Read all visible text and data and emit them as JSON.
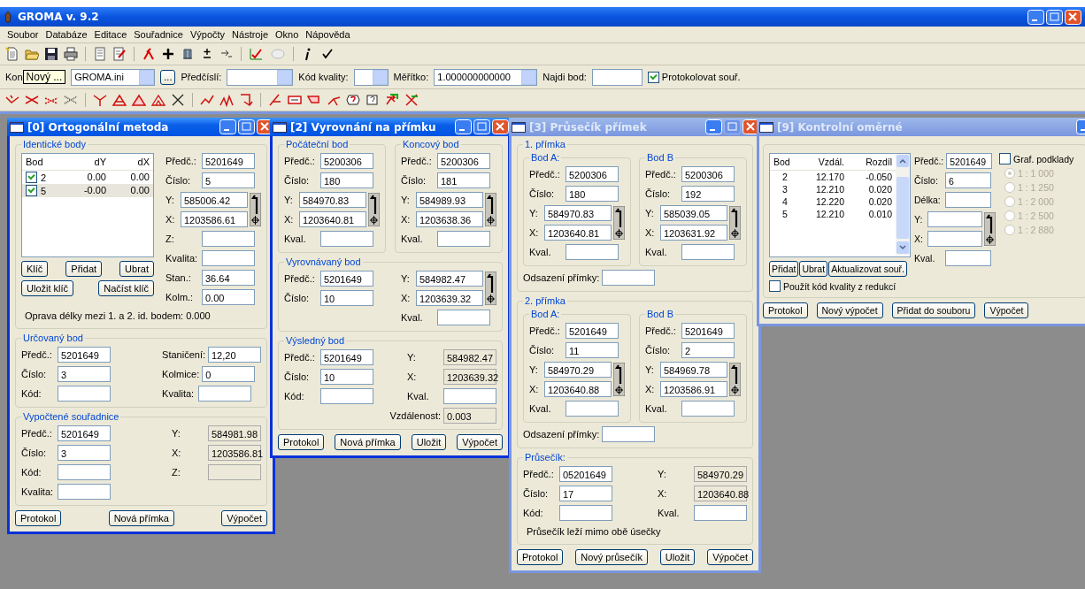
{
  "app": {
    "title": "GROMA v. 9.2"
  },
  "menu": [
    "Soubor",
    "Databáze",
    "Editace",
    "Souřadnice",
    "Výpočty",
    "Nástroje",
    "Okno",
    "Nápověda"
  ],
  "config_bar": [
    {
      "kind": "label",
      "text": "Kon"
    },
    {
      "kind": "tooltip",
      "text": "Nový ..."
    },
    {
      "kind": "combo",
      "value": "GROMA.ini"
    },
    {
      "kind": "button",
      "label": "..."
    },
    {
      "kind": "label",
      "text": "Předčíslí:"
    },
    {
      "kind": "combo"
    },
    {
      "kind": "label",
      "text": "Kód kvality:"
    },
    {
      "kind": "smallcombo"
    },
    {
      "kind": "label",
      "text": "Měřítko:"
    },
    {
      "kind": "combo",
      "value": "1.000000000000"
    },
    {
      "kind": "label",
      "text": "Najdi bod:"
    },
    {
      "kind": "input"
    },
    {
      "kind": "checkbox",
      "label": "Protokolovat souř.",
      "checked": true
    }
  ],
  "windows": [
    {
      "title": "[0] Ortogonální metoda",
      "active": true,
      "content": [
        {
          "kind": "group",
          "legend": "Identické body",
          "items": [
            {
              "kind": "row",
              "items": [
                {
                  "kind": "col",
                  "items": [
                    {
                      "kind": "table",
                      "columns": [
                        "Bod",
                        "dY",
                        "dX"
                      ],
                      "rows": [
                        {
                          "checked": true,
                          "selected": false,
                          "cells": [
                            "2",
                            "0.00",
                            "0.00"
                          ]
                        },
                        {
                          "checked": true,
                          "selected": true,
                          "cells": [
                            "5",
                            "-0.00",
                            "0.00"
                          ]
                        }
                      ]
                    },
                    {
                      "kind": "buttons",
                      "items": [
                        "Klíč",
                        "Přidat",
                        "Ubrat"
                      ]
                    },
                    {
                      "kind": "buttons",
                      "items": [
                        "Uložit klíč",
                        "Načíst klíč"
                      ]
                    }
                  ]
                },
                {
                  "kind": "col",
                  "items": [
                    {
                      "kind": "field",
                      "label": "Předč.:",
                      "value": "5201649"
                    },
                    {
                      "kind": "field",
                      "label": "Číslo:",
                      "value": "5"
                    },
                    {
                      "kind": "coords",
                      "items": [
                        {
                          "kind": "field",
                          "label": "Y:",
                          "value": "585006.42"
                        },
                        {
                          "kind": "field",
                          "label": "X:",
                          "value": "1203586.61"
                        }
                      ]
                    },
                    {
                      "kind": "field",
                      "label": "Z:"
                    },
                    {
                      "kind": "field",
                      "label": "Kvalita:"
                    },
                    {
                      "kind": "field",
                      "label": "Stan.:",
                      "value": "36.64"
                    },
                    {
                      "kind": "field",
                      "label": "Kolm.:",
                      "value": "0.00"
                    }
                  ]
                }
              ]
            },
            {
              "kind": "text",
              "text": "Oprava délky mezi 1. a 2. id. bodem:  0.000"
            }
          ]
        },
        {
          "kind": "group",
          "legend": "Určovaný bod",
          "items": [
            {
              "kind": "row",
              "items": [
                {
                  "kind": "col",
                  "items": [
                    {
                      "kind": "field",
                      "label": "Předč.:",
                      "value": "5201649"
                    },
                    {
                      "kind": "field",
                      "label": "Číslo:",
                      "value": "3"
                    },
                    {
                      "kind": "field",
                      "label": "Kód:"
                    }
                  ]
                },
                {
                  "kind": "col",
                  "items": [
                    {
                      "kind": "field",
                      "label": "Staničení:",
                      "value": "12,20"
                    },
                    {
                      "kind": "field",
                      "label": "Kolmice:",
                      "value": "0"
                    },
                    {
                      "kind": "field",
                      "label": "Kvalita:"
                    }
                  ]
                }
              ]
            }
          ]
        },
        {
          "kind": "group",
          "legend": "Vypočtené souřadnice",
          "items": [
            {
              "kind": "row",
              "items": [
                {
                  "kind": "col",
                  "items": [
                    {
                      "kind": "field",
                      "label": "Předč.:",
                      "value": "5201649"
                    },
                    {
                      "kind": "field",
                      "label": "Číslo:",
                      "value": "3"
                    },
                    {
                      "kind": "field",
                      "label": "Kód:"
                    },
                    {
                      "kind": "field",
                      "label": "Kvalita:"
                    }
                  ]
                },
                {
                  "kind": "col",
                  "items": [
                    {
                      "kind": "output",
                      "label": "Y:",
                      "value": "584981.98"
                    },
                    {
                      "kind": "output",
                      "label": "X:",
                      "value": "1203586.81"
                    },
                    {
                      "kind": "output",
                      "label": "Z:"
                    }
                  ]
                }
              ]
            }
          ]
        },
        {
          "kind": "buttons",
          "items": [
            "Protokol",
            "Nová přímka",
            "Výpočet"
          ]
        }
      ]
    },
    {
      "title": "[2] Vyrovnání na přímku",
      "active": true,
      "content": [
        {
          "kind": "row",
          "items": [
            {
              "kind": "group",
              "legend": "Počáteční bod",
              "items": [
                {
                  "kind": "field",
                  "label": "Předč.:",
                  "value": "5200306"
                },
                {
                  "kind": "field",
                  "label": "Číslo:",
                  "value": "180"
                },
                {
                  "kind": "coords",
                  "items": [
                    {
                      "kind": "field",
                      "label": "Y:",
                      "value": "584970.83"
                    },
                    {
                      "kind": "field",
                      "label": "X:",
                      "value": "1203640.81"
                    }
                  ]
                },
                {
                  "kind": "field",
                  "label": "Kval."
                }
              ]
            },
            {
              "kind": "group",
              "legend": "Koncový bod",
              "items": [
                {
                  "kind": "field",
                  "label": "Předč.:",
                  "value": "5200306"
                },
                {
                  "kind": "field",
                  "label": "Číslo:",
                  "value": "181"
                },
                {
                  "kind": "coords",
                  "items": [
                    {
                      "kind": "field",
                      "label": "Y:",
                      "value": "584989.93"
                    },
                    {
                      "kind": "field",
                      "label": "X:",
                      "value": "1203638.36"
                    }
                  ]
                },
                {
                  "kind": "field",
                  "label": "Kval."
                }
              ]
            }
          ]
        },
        {
          "kind": "group",
          "legend": "Vyrovnávaný bod",
          "items": [
            {
              "kind": "row",
              "items": [
                {
                  "kind": "col",
                  "items": [
                    {
                      "kind": "field",
                      "label": "Předč.:",
                      "value": "5201649"
                    },
                    {
                      "kind": "field",
                      "label": "Číslo:",
                      "value": "10"
                    }
                  ]
                },
                {
                  "kind": "col",
                  "items": [
                    {
                      "kind": "coords",
                      "items": [
                        {
                          "kind": "field",
                          "label": "Y:",
                          "value": "584982.47"
                        },
                        {
                          "kind": "field",
                          "label": "X:",
                          "value": "1203639.32"
                        }
                      ]
                    },
                    {
                      "kind": "field",
                      "label": "Kval."
                    }
                  ]
                }
              ]
            }
          ]
        },
        {
          "kind": "group",
          "legend": "Výsledný bod",
          "items": [
            {
              "kind": "row",
              "items": [
                {
                  "kind": "col",
                  "items": [
                    {
                      "kind": "field",
                      "label": "Předč.:",
                      "value": "5201649"
                    },
                    {
                      "kind": "field",
                      "label": "Číslo:",
                      "value": "10"
                    },
                    {
                      "kind": "field",
                      "label": "Kód:"
                    }
                  ]
                },
                {
                  "kind": "col",
                  "items": [
                    {
                      "kind": "output",
                      "label": "Y:",
                      "value": "584982.47"
                    },
                    {
                      "kind": "output",
                      "label": "X:",
                      "value": "1203639.32"
                    },
                    {
                      "kind": "field",
                      "label": "Kval."
                    }
                  ]
                }
              ]
            },
            {
              "kind": "output",
              "label": "Vzdálenost:",
              "value": "0.003"
            }
          ]
        },
        {
          "kind": "buttons",
          "items": [
            "Protokol",
            "Nová přímka",
            "Uložit",
            "Výpočet"
          ]
        }
      ]
    },
    {
      "title": "[3] Průsečík přímek",
      "active": false,
      "content": [
        {
          "kind": "group",
          "legend": "1. přímka",
          "items": [
            {
              "kind": "row",
              "items": [
                {
                  "kind": "group",
                  "legend": "Bod A:",
                  "items": [
                    {
                      "kind": "field",
                      "label": "Předč.:",
                      "value": "5200306"
                    },
                    {
                      "kind": "field",
                      "label": "Číslo:",
                      "value": "180"
                    },
                    {
                      "kind": "coords",
                      "items": [
                        {
                          "kind": "field",
                          "label": "Y:",
                          "value": "584970.83"
                        },
                        {
                          "kind": "field",
                          "label": "X:",
                          "value": "1203640.81"
                        }
                      ]
                    },
                    {
                      "kind": "field",
                      "label": "Kval."
                    }
                  ]
                },
                {
                  "kind": "group",
                  "legend": "Bod B",
                  "items": [
                    {
                      "kind": "field",
                      "label": "Předč.:",
                      "value": "5200306"
                    },
                    {
                      "kind": "field",
                      "label": "Číslo:",
                      "value": "192"
                    },
                    {
                      "kind": "coords",
                      "items": [
                        {
                          "kind": "field",
                          "label": "Y:",
                          "value": "585039.05"
                        },
                        {
                          "kind": "field",
                          "label": "X:",
                          "value": "1203631.92"
                        }
                      ]
                    },
                    {
                      "kind": "field",
                      "label": "Kval."
                    }
                  ]
                }
              ]
            },
            {
              "kind": "field",
              "label": "Odsazení přímky:"
            }
          ]
        },
        {
          "kind": "group",
          "legend": "2. přímka",
          "items": [
            {
              "kind": "row",
              "items": [
                {
                  "kind": "group",
                  "legend": "Bod A:",
                  "items": [
                    {
                      "kind": "field",
                      "label": "Předč.:",
                      "value": "5201649"
                    },
                    {
                      "kind": "field",
                      "label": "Číslo:",
                      "value": "11"
                    },
                    {
                      "kind": "coords",
                      "items": [
                        {
                          "kind": "field",
                          "label": "Y:",
                          "value": "584970.29"
                        },
                        {
                          "kind": "field",
                          "label": "X:",
                          "value": "1203640.88"
                        }
                      ]
                    },
                    {
                      "kind": "field",
                      "label": "Kval."
                    }
                  ]
                },
                {
                  "kind": "group",
                  "legend": "Bod B",
                  "items": [
                    {
                      "kind": "field",
                      "label": "Předč.:",
                      "value": "5201649"
                    },
                    {
                      "kind": "field",
                      "label": "Číslo:",
                      "value": "2"
                    },
                    {
                      "kind": "coords",
                      "items": [
                        {
                          "kind": "field",
                          "label": "Y:",
                          "value": "584969.78"
                        },
                        {
                          "kind": "field",
                          "label": "X:",
                          "value": "1203586.91"
                        }
                      ]
                    },
                    {
                      "kind": "field",
                      "label": "Kval."
                    }
                  ]
                }
              ]
            },
            {
              "kind": "field",
              "label": "Odsazení přímky:"
            }
          ]
        },
        {
          "kind": "group",
          "legend": "Průsečík:",
          "items": [
            {
              "kind": "row",
              "items": [
                {
                  "kind": "col",
                  "items": [
                    {
                      "kind": "field",
                      "label": "Předč.:",
                      "value": "05201649"
                    },
                    {
                      "kind": "field",
                      "label": "Číslo:",
                      "value": "17"
                    },
                    {
                      "kind": "field",
                      "label": "Kód:"
                    }
                  ]
                },
                {
                  "kind": "col",
                  "items": [
                    {
                      "kind": "output",
                      "label": "Y:",
                      "value": "584970.29"
                    },
                    {
                      "kind": "output",
                      "label": "X:",
                      "value": "1203640.88"
                    },
                    {
                      "kind": "field",
                      "label": "Kval."
                    }
                  ]
                }
              ]
            },
            {
              "kind": "text",
              "text": "Průsečík leží mimo obě úsečky"
            }
          ]
        },
        {
          "kind": "buttons",
          "items": [
            "Protokol",
            "Nový průsečík",
            "Uložit",
            "Výpočet"
          ]
        }
      ]
    },
    {
      "title": "[9] Kontrolní oměrné",
      "active": false,
      "content": [
        {
          "kind": "group",
          "items": [
            {
              "kind": "row",
              "items": [
                {
                  "kind": "col",
                  "items": [
                    {
                      "kind": "scrolltable",
                      "columns": [
                        "Bod",
                        "Vzdál.",
                        "Rozdíl"
                      ],
                      "rows": [
                        {
                          "selected": false,
                          "cells": [
                            "2",
                            "12.170",
                            "-0.050"
                          ]
                        },
                        {
                          "selected": false,
                          "cells": [
                            "3",
                            "12.210",
                            "0.020"
                          ]
                        },
                        {
                          "selected": false,
                          "cells": [
                            "4",
                            "12.220",
                            "0.020"
                          ]
                        },
                        {
                          "selected": false,
                          "cells": [
                            "5",
                            "12.210",
                            "0.010"
                          ]
                        }
                      ]
                    },
                    {
                      "kind": "buttons",
                      "items": [
                        "Přidat",
                        "Ubrat",
                        "Aktualizovat souř."
                      ]
                    }
                  ]
                },
                {
                  "kind": "col",
                  "items": [
                    {
                      "kind": "field",
                      "label": "Předč.:",
                      "value": "5201649"
                    },
                    {
                      "kind": "field",
                      "label": "Číslo:",
                      "value": "6"
                    },
                    {
                      "kind": "field",
                      "label": "Délka:"
                    },
                    {
                      "kind": "coords",
                      "items": [
                        {
                          "kind": "field",
                          "label": "Y:"
                        },
                        {
                          "kind": "field",
                          "label": "X:"
                        }
                      ]
                    },
                    {
                      "kind": "field",
                      "label": "Kval."
                    }
                  ]
                },
                {
                  "kind": "col",
                  "items": [
                    {
                      "kind": "checkbox",
                      "label": "Graf. podklady",
                      "checked": false
                    },
                    {
                      "kind": "radio",
                      "label": "1 : 1 000",
                      "selected": true,
                      "disabled": true
                    },
                    {
                      "kind": "radio",
                      "label": "1 : 1 250",
                      "selected": false,
                      "disabled": true
                    },
                    {
                      "kind": "radio",
                      "label": "1 : 2 000",
                      "selected": false,
                      "disabled": true
                    },
                    {
                      "kind": "radio",
                      "label": "1 : 2 500",
                      "selected": false,
                      "disabled": true
                    },
                    {
                      "kind": "radio",
                      "label": "1 : 2 880",
                      "selected": false,
                      "disabled": true
                    }
                  ]
                }
              ]
            },
            {
              "kind": "checkbox",
              "label": "Použít kód kvality z redukcí",
              "checked": false
            }
          ]
        },
        {
          "kind": "buttons",
          "items": [
            "Protokol",
            "Nový výpočet",
            "Přidat do souboru",
            "Výpočet"
          ]
        }
      ]
    }
  ]
}
